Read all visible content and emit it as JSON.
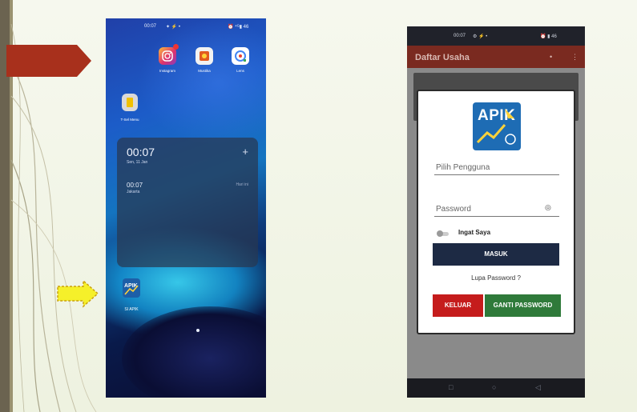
{
  "home_screen": {
    "status_time": "00:07",
    "status_left_extra": "✦ ⚡ •",
    "status_right": "⏰ ⁴ᴳ▮ 46",
    "apps": [
      {
        "label": "Instagram",
        "icon": "instagram-icon"
      },
      {
        "label": "Mustika",
        "icon": "mustika-icon"
      },
      {
        "label": "Lens",
        "icon": "lens-icon"
      }
    ],
    "tsel_app_label": "T-Sel Menu",
    "clock_widget": {
      "time": "00:07",
      "date": "Sen, 11 Jan",
      "plus": "+",
      "world_time": "00:07",
      "world_city": "Jakarta",
      "world_note": "Hari ini"
    },
    "apik_app_label": "SI APIK"
  },
  "login_screen": {
    "status_time": "00:07",
    "status_extra": "⚙ ⚡ •",
    "status_right": "⏰ ▮ 46",
    "appbar_title": "Daftar Usaha",
    "logo_text": "APIK",
    "user_field_label": "Pilih Pengguna",
    "password_field_label": "Password",
    "remember_label": "Ingat Saya",
    "login_button": "MASUK",
    "forgot_link": "Lupa Password ?",
    "exit_button": "KELUAR",
    "change_password_button": "GANTI PASSWORD",
    "nav_icons": [
      "□",
      "○",
      "◁"
    ]
  },
  "colors": {
    "appbar": "#7a2a20",
    "login_button": "#1d2a44",
    "exit_button": "#c51c1c",
    "change_password_button": "#2f7a3a",
    "logo_bg": "#1e6cb4"
  }
}
